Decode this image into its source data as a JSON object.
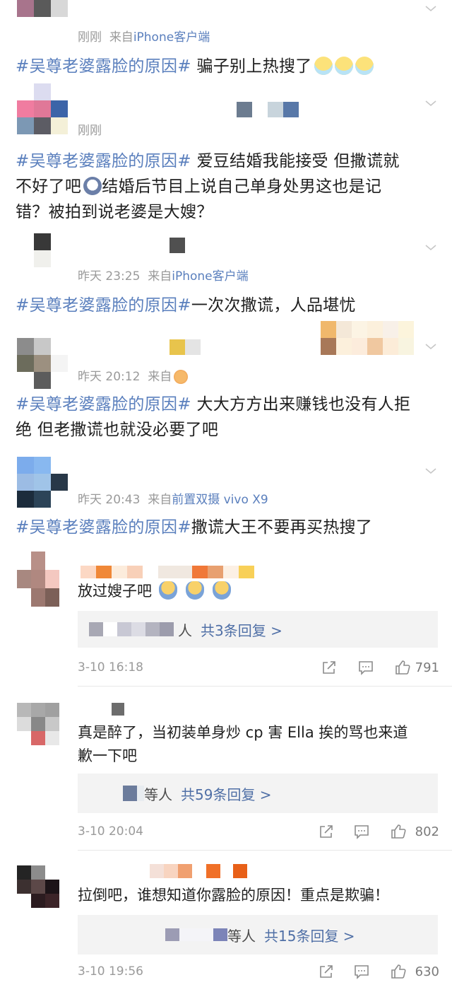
{
  "posts": [
    {
      "time": "刚刚",
      "from": "来自",
      "source": "iPhone客户端",
      "tag": "#吴尊老婆露脸的原因#",
      "body": " 骗子别上热搜了",
      "emojis": [
        "sick-face-icon",
        "sick-face-icon",
        "sick-face-icon"
      ]
    },
    {
      "time": "刚刚",
      "from": "",
      "source": "",
      "tag": "#吴尊老婆露脸的原因#",
      "body_line1": " 爱豆结婚我能接受 但撒谎就",
      "body_line2a": "不好了吧",
      "body_line2b": "结婚后节目上说自己单身处男这也是记",
      "body_line3": "错？被拍到说老婆是大嫂？"
    },
    {
      "time": "昨天 23:25",
      "from": "来自",
      "source": "iPhone客户端",
      "tag": "#吴尊老婆露脸的原因#",
      "body": "一次次撒谎，人品堪忧"
    },
    {
      "time": "昨天 20:12",
      "from": "来自",
      "source": "",
      "tag": "#吴尊老婆露脸的原因#",
      "body_line1": " 大大方方出来赚钱也没有人拒",
      "body_line2": "绝 但老撒谎也就没必要了吧"
    },
    {
      "time": "昨天 20:43",
      "from": "来自",
      "source": "前置双摄 vivo X9",
      "tag": "#吴尊老婆露脸的原因#",
      "body": "撒谎大王不要再买热搜了"
    }
  ],
  "comments": [
    {
      "text": "放过嫂子吧",
      "emojis": [
        "pray-icon",
        "pray-icon",
        "pray-icon"
      ],
      "reply_who": "人",
      "reply_count": "共3条回复 >",
      "time": "3-10 16:18",
      "likes": "791"
    },
    {
      "text_line1": "真是醉了，当初装单身炒 cp 害 Ella 挨的骂也来道",
      "text_line2": "歉一下吧",
      "reply_who": "等人",
      "reply_count": "共59条回复 >",
      "time": "3-10 20:04",
      "likes": "802"
    },
    {
      "text": "拉倒吧，谁想知道你露脸的原因！重点是欺骗！",
      "reply_who": "等人",
      "reply_count": "共15条回复 >",
      "time": "3-10 19:56",
      "likes": "630"
    }
  ],
  "colors": {
    "link": "#5a7fbd",
    "meta": "#9a9a9a",
    "reply_bg": "#f3f3f3"
  }
}
